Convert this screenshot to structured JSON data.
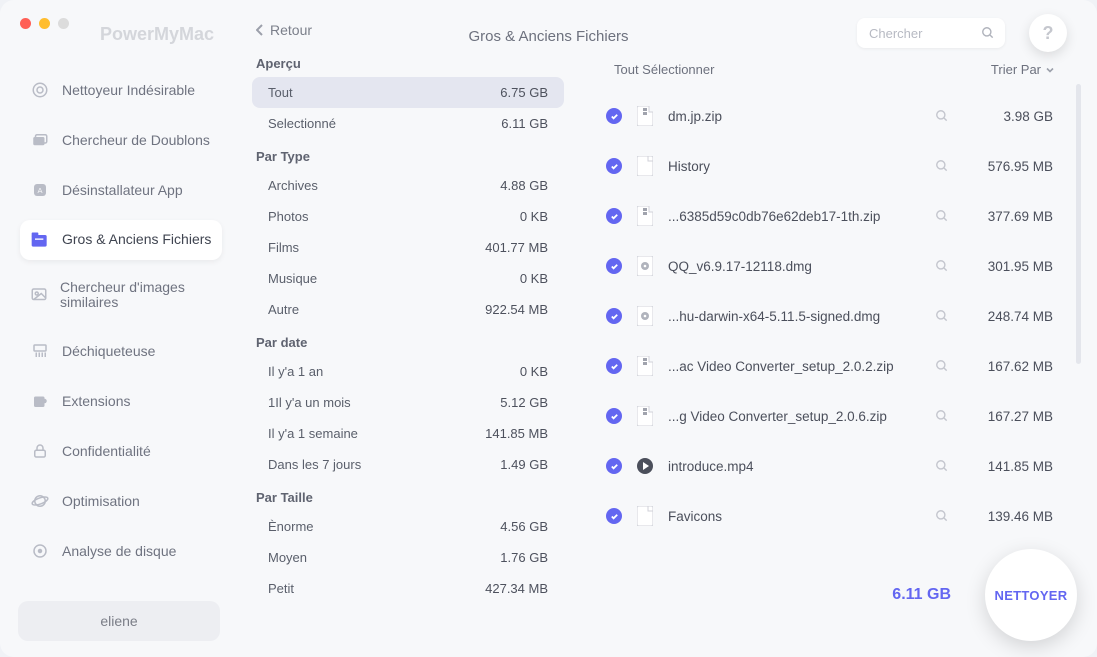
{
  "app": {
    "title": "PowerMyMac",
    "page_title": "Gros & Anciens Fichiers",
    "back_label": "Retour",
    "search_placeholder": "Chercher",
    "help_label": "?",
    "user": "eliene"
  },
  "sidebar": [
    {
      "label": "Nettoyeur Indésirable",
      "icon": "target"
    },
    {
      "label": "Chercheur de Doublons",
      "icon": "folders"
    },
    {
      "label": "Désinstallateur App",
      "icon": "app"
    },
    {
      "label": "Gros & Anciens Fichiers",
      "icon": "files",
      "active": true
    },
    {
      "label": "Chercheur d'images similaires",
      "icon": "image"
    },
    {
      "label": "Déchiqueteuse",
      "icon": "shredder"
    },
    {
      "label": "Extensions",
      "icon": "puzzle"
    },
    {
      "label": "Confidentialité",
      "icon": "lock"
    },
    {
      "label": "Optimisation",
      "icon": "planet"
    },
    {
      "label": "Analyse de disque",
      "icon": "disk"
    }
  ],
  "filters": {
    "apercu": {
      "title": "Aperçu",
      "rows": [
        {
          "label": "Tout",
          "val": "6.75 GB",
          "active": true
        },
        {
          "label": "Selectionné",
          "val": "6.11 GB"
        }
      ]
    },
    "par_type": {
      "title": "Par Type",
      "rows": [
        {
          "label": "Archives",
          "val": "4.88 GB"
        },
        {
          "label": "Photos",
          "val": "0 KB"
        },
        {
          "label": "Films",
          "val": "401.77 MB"
        },
        {
          "label": "Musique",
          "val": "0 KB"
        },
        {
          "label": "Autre",
          "val": "922.54 MB"
        }
      ]
    },
    "par_date": {
      "title": "Par date",
      "rows": [
        {
          "label": "Il y'a 1 an",
          "val": "0 KB"
        },
        {
          "label": "1Il y'a un mois",
          "val": "5.12 GB"
        },
        {
          "label": "Il y'a 1 semaine",
          "val": "141.85 MB"
        },
        {
          "label": "Dans les 7 jours",
          "val": "1.49 GB"
        }
      ]
    },
    "par_taille": {
      "title": "Par Taille",
      "rows": [
        {
          "label": "Ènorme",
          "val": "4.56 GB"
        },
        {
          "label": "Moyen",
          "val": "1.76 GB"
        },
        {
          "label": "Petit",
          "val": "427.34 MB"
        }
      ]
    }
  },
  "list": {
    "select_all": "Tout Sélectionner",
    "sort_by": "Trier Par",
    "files": [
      {
        "name": "dm.jp.zip",
        "size": "3.98 GB",
        "type": "zip"
      },
      {
        "name": "History",
        "size": "576.95 MB",
        "type": "file"
      },
      {
        "name": "...6385d59c0db76e62deb17-1th.zip",
        "size": "377.69 MB",
        "type": "zip"
      },
      {
        "name": "QQ_v6.9.17-12118.dmg",
        "size": "301.95 MB",
        "type": "dmg"
      },
      {
        "name": "...hu-darwin-x64-5.11.5-signed.dmg",
        "size": "248.74 MB",
        "type": "dmg"
      },
      {
        "name": "...ac Video Converter_setup_2.0.2.zip",
        "size": "167.62 MB",
        "type": "zip"
      },
      {
        "name": "...g Video Converter_setup_2.0.6.zip",
        "size": "167.27 MB",
        "type": "zip"
      },
      {
        "name": "introduce.mp4",
        "size": "141.85 MB",
        "type": "video"
      },
      {
        "name": "Favicons",
        "size": "139.46 MB",
        "type": "file"
      }
    ]
  },
  "footer": {
    "total": "6.11 GB",
    "clean_label": "NETTOYER"
  }
}
